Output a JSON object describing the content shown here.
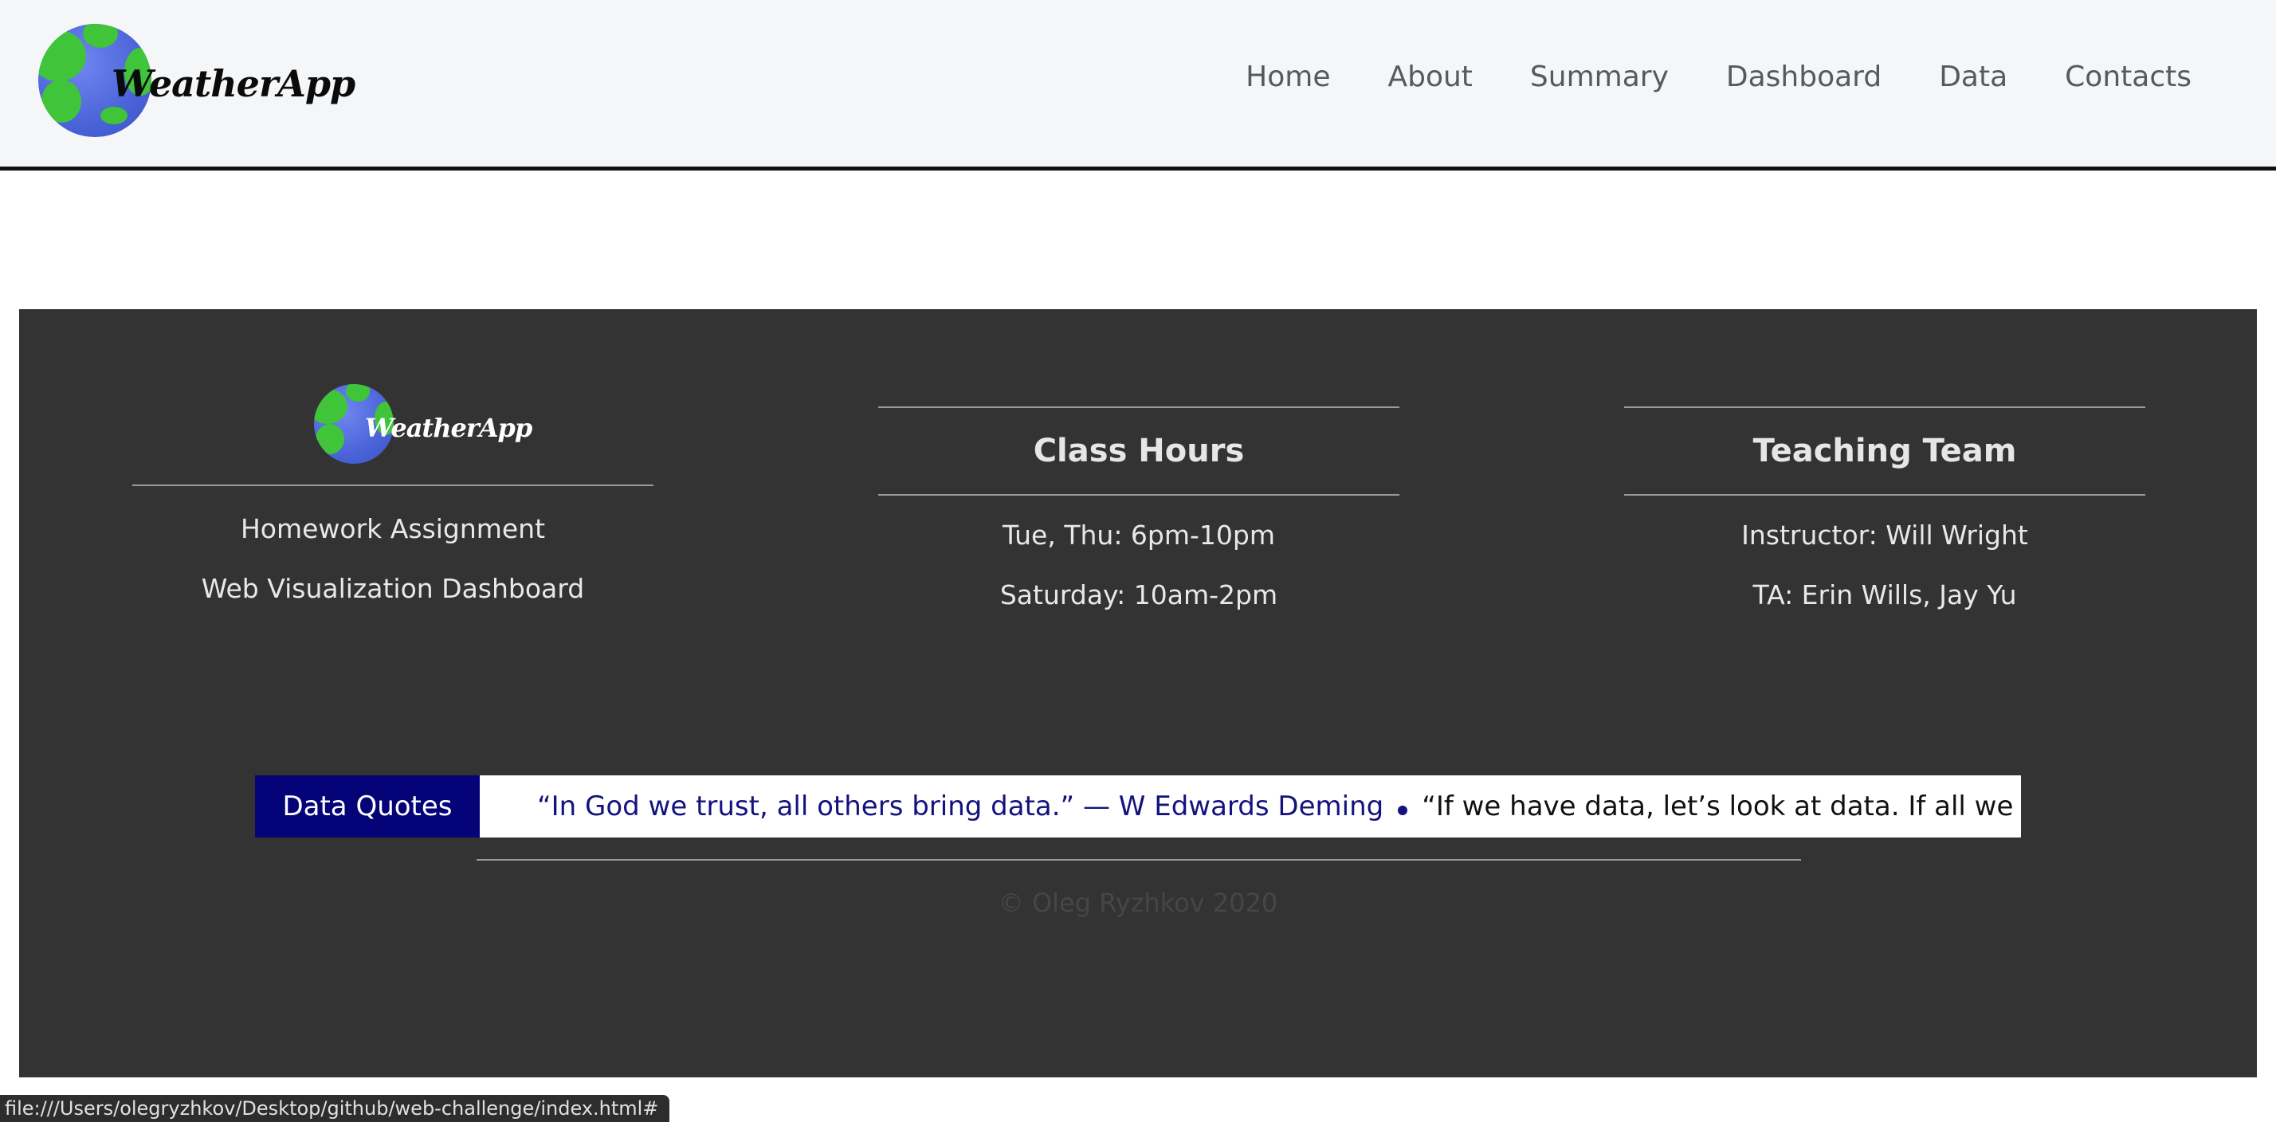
{
  "header": {
    "logo_text": "WeatherApp",
    "nav": [
      "Home",
      "About",
      "Summary",
      "Dashboard",
      "Data",
      "Contacts"
    ]
  },
  "footer": {
    "logo_text": "WeatherApp",
    "col1": {
      "line1": "Homework Assignment",
      "line2": "Web Visualization Dashboard"
    },
    "col2": {
      "title": "Class Hours",
      "line1": "Tue, Thu: 6pm-10pm",
      "line2": "Saturday: 10am-2pm"
    },
    "col3": {
      "title": "Teaching Team",
      "line1": "Instructor: Will Wright",
      "line2": "TA: Erin Wills, Jay Yu"
    },
    "ticker": {
      "label": "Data Quotes",
      "quote1": "“In God we trust, all others bring data.” — W Edwards Deming",
      "quote2": "“If we have data, let’s look at data. If all we have are op"
    },
    "copyright": "© Oleg Ryzhkov 2020"
  },
  "statusbar": {
    "url": "file:///Users/olegryzhkov/Desktop/github/web-challenge/index.html#"
  },
  "colors": {
    "header_bg": "#f5f6f8",
    "panel_bg": "#333333",
    "ticker_label_bg": "#040478",
    "quote_color": "#14127e"
  }
}
